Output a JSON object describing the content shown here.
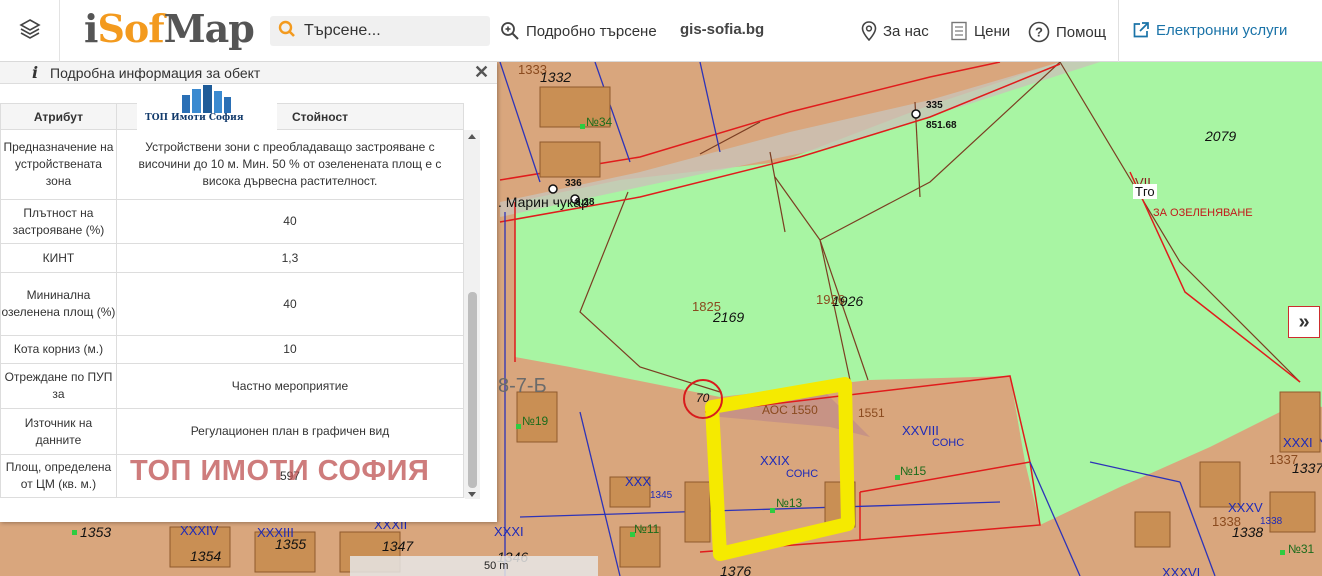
{
  "header": {
    "logo_text_1": "i",
    "logo_text_2": "S",
    "logo_text_3": "of",
    "logo_text_4": "Map",
    "search_placeholder": "Търсене...",
    "advanced_search": "Подробно търсене",
    "gis_link": "gis-sofia.bg",
    "about": "За нас",
    "prices": "Цени",
    "help": "Помощ",
    "eservices": "Електронни услуги"
  },
  "panel": {
    "title": "Подробна информация за обект",
    "col_attr": "Атрибут",
    "col_value": "Стойност",
    "logo_caption": "ТОП Имоти София",
    "watermark": "ТОП ИМОТИ СОФИЯ",
    "rows": [
      {
        "attr": "Предназначение на устройствената зона",
        "value": "Устройствени зони с преобладаващо застрояване с височини до 10 м. Мин. 50 % от озеленената площ е с висока дървесна растителност."
      },
      {
        "attr": "Плътност на застрояване (%)",
        "value": "40"
      },
      {
        "attr": "КИНТ",
        "value": "1,3"
      },
      {
        "attr": "Мининална озеленена площ (%)",
        "value": "40"
      },
      {
        "attr": "Кота корниз (м.)",
        "value": "10"
      },
      {
        "attr": "Отреждане по ПУП за",
        "value": "Частно мероприятие"
      },
      {
        "attr": "Източник на данните",
        "value": "Регулационен план в графичен вид"
      },
      {
        "attr": "Площ, определена от ЦМ (кв. м.)",
        "value": "597"
      }
    ]
  },
  "map": {
    "scale": "50 m",
    "labels": {
      "p1332": "1332",
      "p1333": "1333",
      "n34": "№34",
      "p335": "335",
      "h851": "851.68",
      "p336": "336",
      "h8": "8.28",
      "street": ". Марин чукар",
      "p2079": "2079",
      "vii": "VII",
      "tgo": "Тго",
      "ozel": "ЗА ОЗЕЛЕНЯВАНЕ",
      "p1825": "1825",
      "p2169": "2169",
      "p1926a": "1926",
      "p1926b": "1926",
      "block": "8-7-Б",
      "n19": "№19",
      "p70": "70",
      "aoc": "АОС 1550",
      "p1551": "1551",
      "xxviii": "XXVIII",
      "sons1": "СОНС",
      "xxix": "XXIX",
      "sons2": "СОНС",
      "n15": "№15",
      "xxx": "XXX",
      "p1345": "1345",
      "n13": "№13",
      "n11": "№11",
      "xxxiv": "XXXIV",
      "xxxiii": "XXXIII",
      "xxxii": "XXXII",
      "xxxi": "XXXI",
      "p1353": "1353",
      "p1354": "1354",
      "p1355": "1355",
      "p1347": "1347",
      "p1346": "1346",
      "p1376": "1376",
      "xxxv": "XXXV",
      "p1338": "1338",
      "p1338b": "1338",
      "p1337": "1337",
      "xxxi2": "XXXI",
      "n31": "№31",
      "xxxvi": "XXXVI"
    }
  },
  "colors": {
    "land": "#d9a67d",
    "green_zone": "#a8f5a3",
    "highlight": "#f5ea00",
    "accent": "#f39a1e",
    "boundary_red": "#e01c1c",
    "boundary_blue": "#2d33b8"
  }
}
